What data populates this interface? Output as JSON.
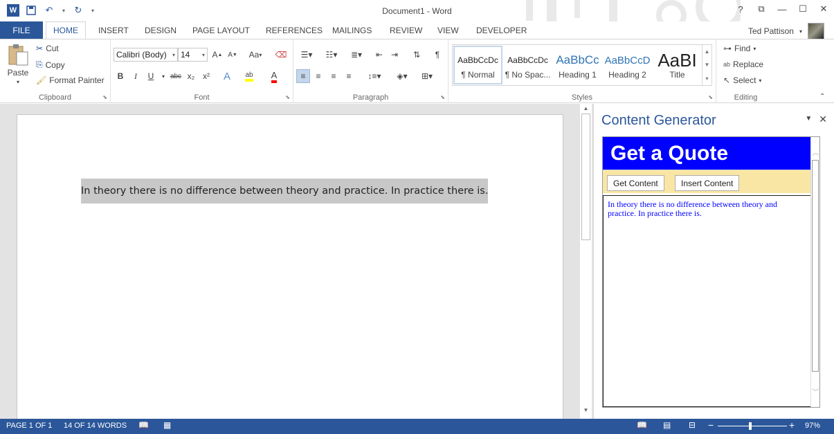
{
  "app": {
    "title": "Document1 - Word"
  },
  "window_controls": {
    "help": "?",
    "ribbon_display": "⧉",
    "minimize": "—",
    "restore": "☐",
    "close": "✕"
  },
  "tabs": [
    {
      "label": "FILE"
    },
    {
      "label": "HOME"
    },
    {
      "label": "INSERT"
    },
    {
      "label": "DESIGN"
    },
    {
      "label": "PAGE LAYOUT"
    },
    {
      "label": "REFERENCES"
    },
    {
      "label": "MAILINGS"
    },
    {
      "label": "REVIEW"
    },
    {
      "label": "VIEW"
    },
    {
      "label": "DEVELOPER"
    }
  ],
  "user": {
    "name": "Ted Pattison"
  },
  "ribbon": {
    "clipboard": {
      "paste": "Paste",
      "cut": "Cut",
      "copy": "Copy",
      "format_painter": "Format Painter",
      "label": "Clipboard"
    },
    "font": {
      "font_name": "Calibri (Body)",
      "font_size": "14",
      "grow": "A",
      "shrink": "A",
      "change_case": "Aa",
      "bold": "B",
      "italic": "I",
      "underline": "U",
      "strike": "abc",
      "subscript": "x₂",
      "superscript": "x²",
      "label": "Font"
    },
    "paragraph": {
      "label": "Paragraph"
    },
    "styles": {
      "items": [
        {
          "preview": "AaBbCcDc",
          "name": "¶ Normal"
        },
        {
          "preview": "AaBbCcDc",
          "name": "¶ No Spac..."
        },
        {
          "preview": "AaBbCc",
          "name": "Heading 1"
        },
        {
          "preview": "AaBbCcD",
          "name": "Heading 2"
        },
        {
          "preview": "AaBI",
          "name": "Title"
        }
      ],
      "label": "Styles"
    },
    "editing": {
      "find": "Find",
      "replace": "Replace",
      "select": "Select",
      "label": "Editing"
    }
  },
  "document": {
    "text": "In theory there is no difference between theory and practice. In practice there is."
  },
  "task_pane": {
    "title": "Content Generator",
    "header": "Get a Quote",
    "get_content": "Get Content",
    "insert_content": "Insert Content",
    "result_text": "In theory there is no difference between theory and practice. In practice there is."
  },
  "status": {
    "page": "PAGE 1 OF 1",
    "words": "14 OF 14 WORDS",
    "zoom": "97%"
  },
  "colors": {
    "word_blue": "#2b579a",
    "quote_header": "#0000ff",
    "button_bar": "#fae6a4",
    "selection": "#c8c8c8"
  }
}
